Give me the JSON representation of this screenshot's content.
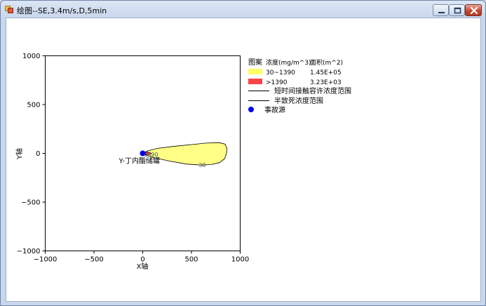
{
  "window": {
    "title": "绘图--SE,3.4m/s,D,5min",
    "controls": [
      "minimize",
      "maximize",
      "close"
    ],
    "icons": {
      "app": "app-icon",
      "minimize": "minimize-icon",
      "maximize": "maximize-icon",
      "close": "close-icon"
    }
  },
  "chart_data": {
    "type": "scatter",
    "title": "",
    "xlabel": "X轴",
    "ylabel": "Y轴",
    "xlim": [
      -1000,
      1000
    ],
    "ylim": [
      -1000,
      1000
    ],
    "xticks": [
      -1000,
      -500,
      0,
      500,
      1000
    ],
    "yticks": [
      1000,
      500,
      0,
      -500,
      -1000
    ],
    "xtick_labels": [
      "−1000",
      "−500",
      "0",
      "500",
      "1000"
    ],
    "ytick_labels": [
      "1000",
      "500",
      "0",
      "−500",
      "−1000"
    ],
    "grid": false,
    "legend_position": "right",
    "legend": {
      "headers": [
        "图案",
        "浓度(mg/m^3)",
        "面积(m^2)"
      ],
      "rows": [
        {
          "color": "#ffff66",
          "range": "30~1390",
          "area": "1.45E+05"
        },
        {
          "color": "#ff4444",
          "range": ">1390",
          "area": "3.23E+03"
        }
      ],
      "lines": [
        "短时间接触容许浓度范围",
        "半致死浓度范围"
      ],
      "marker": {
        "color": "#0000ee",
        "label": "事故源"
      }
    },
    "contours": [
      {
        "level": 30,
        "label": "30",
        "color": "#ffff88",
        "label_at": [
          610,
          -120
        ],
        "points": [
          [
            0,
            0
          ],
          [
            50,
            25
          ],
          [
            150,
            50
          ],
          [
            300,
            70
          ],
          [
            500,
            90
          ],
          [
            650,
            105
          ],
          [
            780,
            110
          ],
          [
            845,
            95
          ],
          [
            865,
            50
          ],
          [
            860,
            0
          ],
          [
            840,
            -55
          ],
          [
            790,
            -95
          ],
          [
            700,
            -115
          ],
          [
            600,
            -120
          ],
          [
            450,
            -110
          ],
          [
            280,
            -80
          ],
          [
            120,
            -45
          ],
          [
            30,
            -15
          ],
          [
            0,
            0
          ]
        ]
      },
      {
        "level": 1390,
        "label": "1390",
        "color": "#ff4444",
        "label_at": [
          85,
          -10
        ],
        "points": [
          [
            0,
            0
          ],
          [
            20,
            10
          ],
          [
            50,
            12
          ],
          [
            75,
            8
          ],
          [
            85,
            0
          ],
          [
            75,
            -9
          ],
          [
            50,
            -12
          ],
          [
            20,
            -9
          ],
          [
            0,
            0
          ]
        ]
      }
    ],
    "source": {
      "x": 0,
      "y": 0,
      "label": "Y-丁内酯储罐",
      "marker": "事故源"
    }
  }
}
